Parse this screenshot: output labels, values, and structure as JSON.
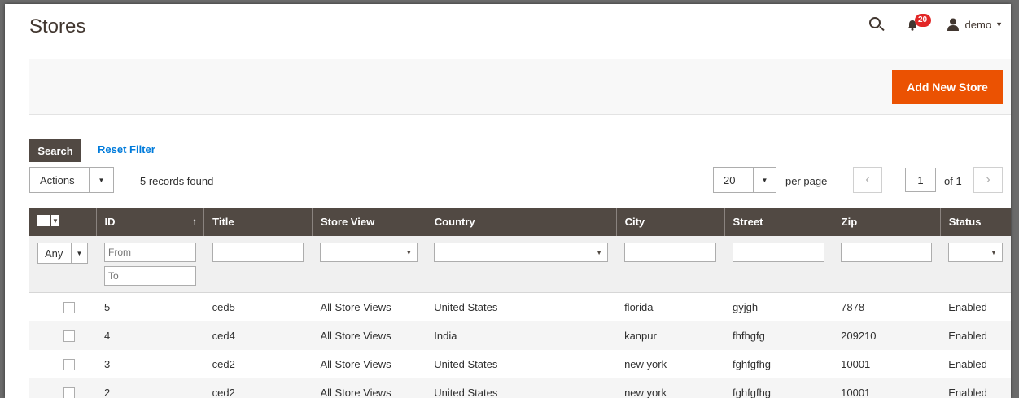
{
  "header": {
    "title": "Stores",
    "notifications_count": "20",
    "user_name": "demo"
  },
  "action_bar": {
    "add_label": "Add New Store"
  },
  "toolbar": {
    "search_label": "Search",
    "reset_label": "Reset Filter",
    "actions_label": "Actions",
    "records_found": "5 records found",
    "per_page_value": "20",
    "per_page_label": "per page",
    "current_page": "1",
    "page_of": "of 1",
    "prev_glyph": "‹",
    "next_glyph": "›"
  },
  "columns": [
    "ID",
    "Title",
    "Store View",
    "Country",
    "City",
    "Street",
    "Zip",
    "Status"
  ],
  "filters": {
    "any_label": "Any",
    "id_from_placeholder": "From",
    "id_to_placeholder": "To"
  },
  "rows": [
    {
      "id": "5",
      "title": "ced5",
      "store_view": "All Store Views",
      "country": "United States",
      "city": "florida",
      "street": "gyjgh",
      "zip": "7878",
      "status": "Enabled"
    },
    {
      "id": "4",
      "title": "ced4",
      "store_view": "All Store Views",
      "country": "India",
      "city": "kanpur",
      "street": "fhfhgfg",
      "zip": "209210",
      "status": "Enabled"
    },
    {
      "id": "3",
      "title": "ced2",
      "store_view": "All Store Views",
      "country": "United States",
      "city": "new york",
      "street": "fghfgfhg",
      "zip": "10001",
      "status": "Enabled"
    },
    {
      "id": "2",
      "title": "ced2",
      "store_view": "All Store Views",
      "country": "United States",
      "city": "new york",
      "street": "fghfgfhg",
      "zip": "10001",
      "status": "Enabled"
    }
  ],
  "colors": {
    "accent": "#eb5202",
    "header_dark": "#514943",
    "link": "#007bdb",
    "badge": "#e22626"
  }
}
